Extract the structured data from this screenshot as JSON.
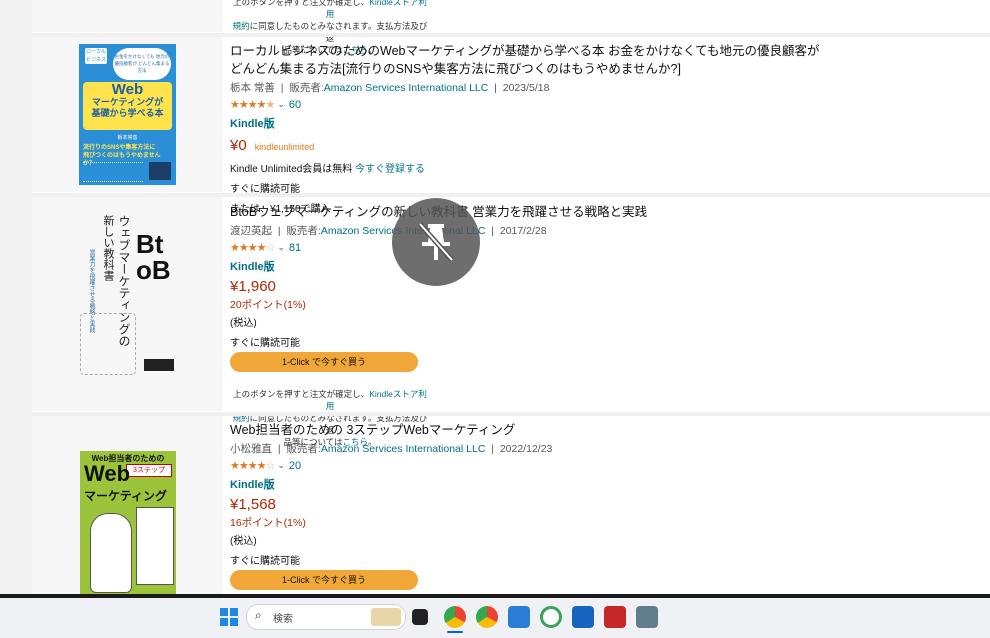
{
  "top_note": {
    "line1_pre": "上のボタンを押すと注文が確定し、",
    "line1_link": "Kindleストア利用",
    "line2_link": "規約",
    "line2_post": "に同意したものとみなされます。支払方法及び返",
    "line3_pre": "品等については",
    "line3_link": "こちら",
    "line3_post": "。"
  },
  "products": [
    {
      "title": "ローカルビジネスのためのWebマーケティングが基礎から学べる本 お金をかけなくても地元の優良顧客がどんどん集まる方法[流行りのSNSや集客方法に飛びつくのはもうやめませんか?]",
      "author": "栃本 常善",
      "seller_label": "販売者:",
      "seller": "Amazon Services International LLC",
      "date": "2023/5/18",
      "rating": 4.5,
      "review_count": "60",
      "format": "Kindle版",
      "price": "¥0",
      "ku_brand": "kindleunlimited",
      "ku_text": "Kindle Unlimited会員は無料",
      "ku_link": "今すぐ登録する",
      "availability": "すぐに購読可能",
      "alt_price": "または、¥1,150で購入",
      "cover": {
        "top_text": "お金をかけなくても 地元の優良顧客が どんどん集まる方法",
        "tag": "ローカル ビジネス",
        "big1": "Web",
        "big2": "マーケティングが",
        "big3": "基礎から学べる本",
        "author": "栃本常善",
        "yellow1": "流行りのSNSや集客方法に",
        "yellow2": "飛びつくのはもうやめませんか？"
      }
    },
    {
      "title": "BtoBウェブマーケティングの新しい教科書 営業力を飛躍させる戦略と実践",
      "author": "渡辺英起",
      "seller_label": "販売者:",
      "seller": "Amazon Services International LLC",
      "date": "2017/2/28",
      "rating": 4,
      "review_count": "81",
      "format": "Kindle版",
      "price": "¥1,960",
      "points": "20ポイント(1%)",
      "tax": "(税込)",
      "availability": "すぐに購読可能",
      "buy_label": "1-Click で今すぐ買う",
      "cover": {
        "big": "BtoB",
        "vertical1": "ウェブマーケティングの",
        "vertical2": "新しい教科書",
        "sub": "営業力を飛躍させる戦略と実践"
      }
    },
    {
      "title": "Web担当者のための 3ステップWebマーケティング",
      "author": "小松雅直",
      "seller_label": "販売者:",
      "seller": "Amazon Services International LLC",
      "date": "2022/12/23",
      "rating": 4,
      "review_count": "20",
      "format": "Kindle版",
      "price": "¥1,568",
      "points": "16ポイント(1%)",
      "tax": "(税込)",
      "availability": "すぐに購読可能",
      "buy_label": "1-Click で今すぐ買う",
      "cover": {
        "top": "Web担当者のための",
        "badge": "3ステップ",
        "big1": "Web",
        "big2": "マーケティング"
      }
    }
  ],
  "taskbar": {
    "search_placeholder": "検索"
  },
  "colors": {
    "link": "#007185",
    "price": "#b12704",
    "star": "#de7921",
    "buy_button": "#f0a737"
  }
}
